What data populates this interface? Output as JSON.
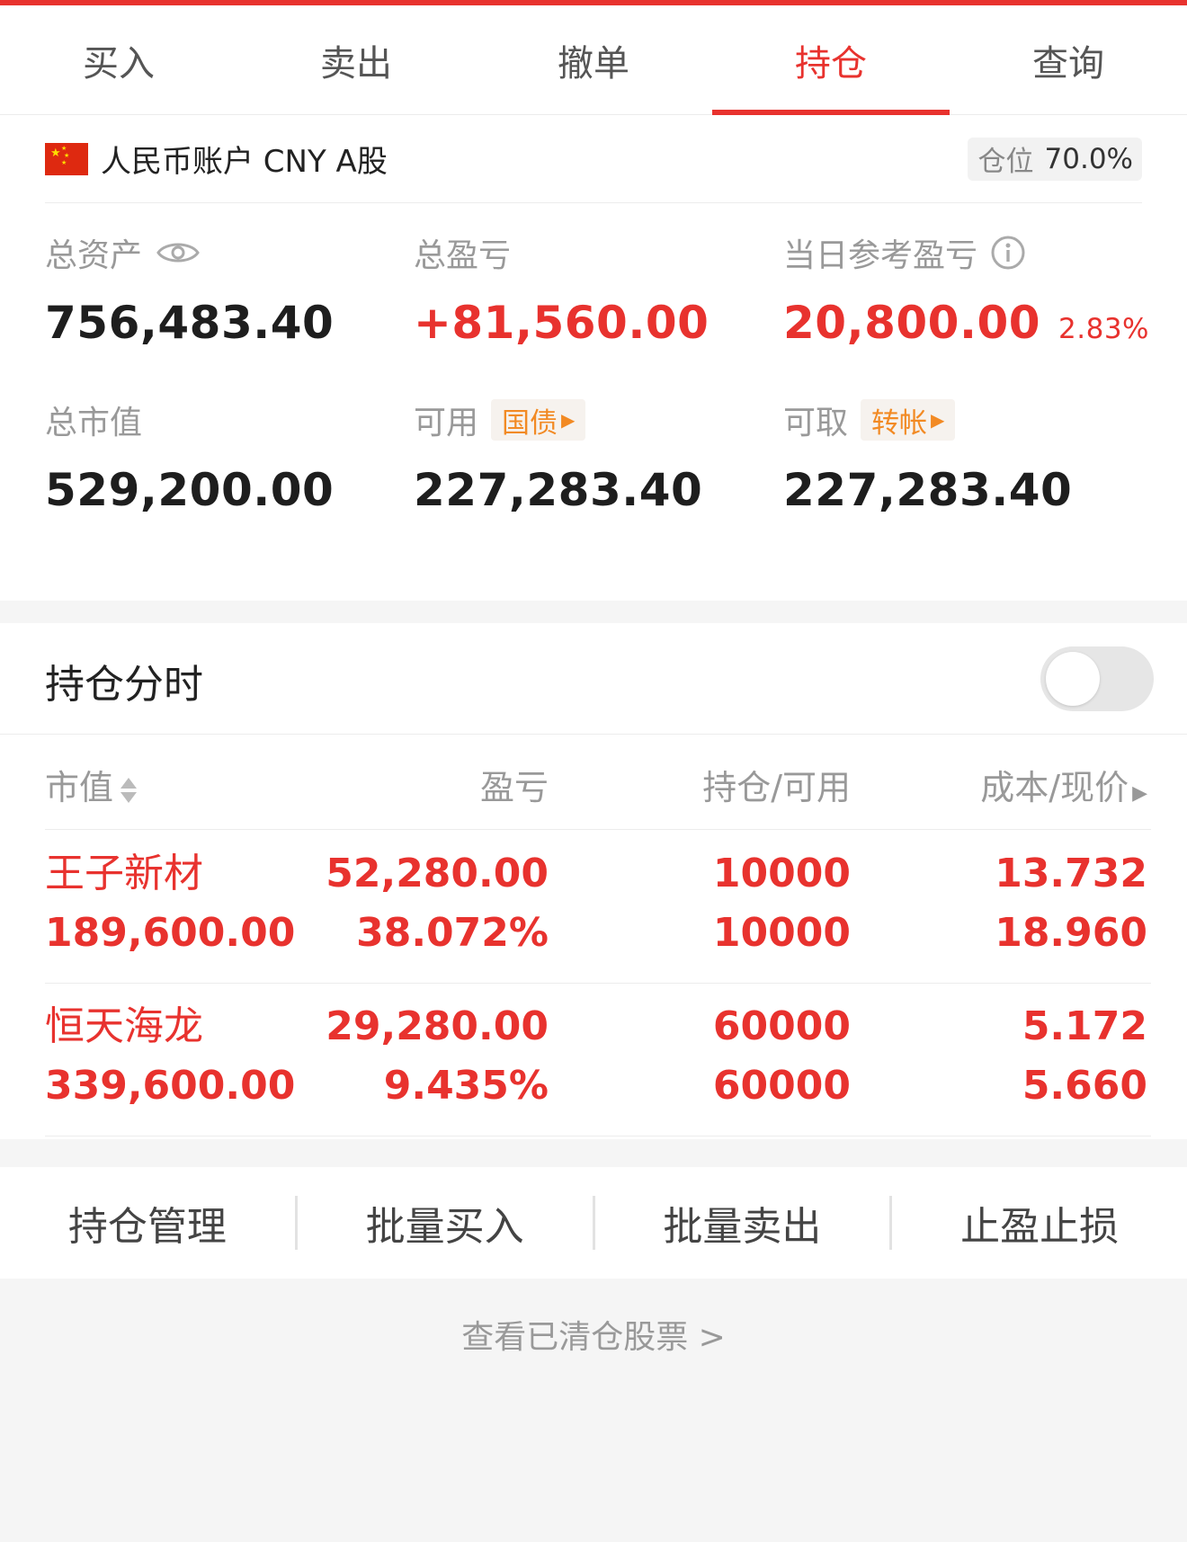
{
  "tabs": [
    {
      "label": "买入",
      "active": false
    },
    {
      "label": "卖出",
      "active": false
    },
    {
      "label": "撤单",
      "active": false
    },
    {
      "label": "持仓",
      "active": true
    },
    {
      "label": "查询",
      "active": false
    }
  ],
  "account": {
    "name": "人民币账户 CNY A股",
    "position_label": "仓位",
    "position_value": "70.0%"
  },
  "metrics": {
    "total_assets": {
      "label": "总资产",
      "value": "756,483.40"
    },
    "total_pnl": {
      "label": "总盈亏",
      "value": "+81,560.00"
    },
    "daily_pnl": {
      "label": "当日参考盈亏",
      "value": "20,800.00",
      "pct": "2.83%"
    },
    "market_value": {
      "label": "总市值",
      "value": "529,200.00"
    },
    "available": {
      "label": "可用",
      "tag": "国债",
      "value": "227,283.40"
    },
    "withdrawable": {
      "label": "可取",
      "tag": "转帐",
      "value": "227,283.40"
    }
  },
  "holdings": {
    "title": "持仓分时",
    "toggle_on": false,
    "columns": [
      "市值",
      "盈亏",
      "持仓/可用",
      "成本/现价"
    ],
    "rows": [
      {
        "name": "王子新材",
        "market_value": "189,600.00",
        "pnl": "52,280.00",
        "pnl_pct": "38.072%",
        "position": "10000",
        "available": "10000",
        "cost": "13.732",
        "price": "18.960"
      },
      {
        "name": "恒天海龙",
        "market_value": "339,600.00",
        "pnl": "29,280.00",
        "pnl_pct": "9.435%",
        "position": "60000",
        "available": "60000",
        "cost": "5.172",
        "price": "5.660"
      }
    ]
  },
  "actions": [
    "持仓管理",
    "批量买入",
    "批量卖出",
    "止盈止损"
  ],
  "cleared_link": "查看已清仓股票 >",
  "colors": {
    "accent": "#e8322e",
    "tag": "#f28a24"
  }
}
